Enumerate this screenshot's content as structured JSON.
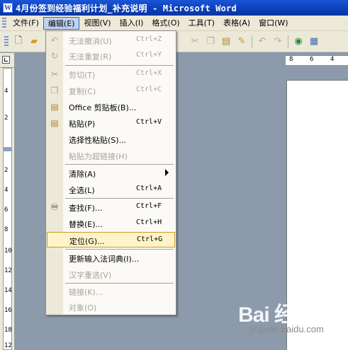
{
  "window": {
    "title": "4月份签到经验福利计划_补充说明 - Microsoft Word",
    "icon_letter": "W"
  },
  "menubar": {
    "items": [
      {
        "label": "文件(F)",
        "id": "file"
      },
      {
        "label": "编辑(E)",
        "id": "edit"
      },
      {
        "label": "视图(V)",
        "id": "view"
      },
      {
        "label": "插入(I)",
        "id": "insert"
      },
      {
        "label": "格式(O)",
        "id": "format"
      },
      {
        "label": "工具(T)",
        "id": "tools"
      },
      {
        "label": "表格(A)",
        "id": "table"
      },
      {
        "label": "窗口(W)",
        "id": "window"
      }
    ]
  },
  "toolbar": {
    "icons": [
      "new-icon",
      "open-icon",
      "save-icon",
      "cut-icon",
      "copy-icon",
      "paste-icon",
      "format-painter-icon",
      "undo-icon",
      "redo-icon",
      "hyperlink-icon",
      "tables-icon"
    ]
  },
  "ruler": {
    "h_labels": [
      "8",
      "6",
      "4"
    ],
    "v_labels": [
      "4",
      "2",
      "2",
      "4",
      "6",
      "8",
      "10",
      "12",
      "14",
      "16",
      "18",
      "12"
    ]
  },
  "edit_menu": {
    "items": [
      {
        "label": "无法撤消(U)",
        "shortcut": "Ctrl+Z",
        "disabled": true,
        "icon": "undo-icon"
      },
      {
        "label": "无法重复(R)",
        "shortcut": "Ctrl+Y",
        "disabled": true,
        "icon": "redo-icon"
      },
      {
        "label": "剪切(T)",
        "shortcut": "Ctrl+X",
        "disabled": true,
        "icon": "cut-icon"
      },
      {
        "label": "复制(C)",
        "shortcut": "Ctrl+C",
        "disabled": true,
        "icon": "copy-icon"
      },
      {
        "label": "Office 剪贴板(B)...",
        "shortcut": "",
        "disabled": false,
        "icon": "clipboard-icon"
      },
      {
        "label": "粘贴(P)",
        "shortcut": "Ctrl+V",
        "disabled": false,
        "icon": "paste-icon"
      },
      {
        "label": "选择性粘贴(S)...",
        "shortcut": "",
        "disabled": false,
        "icon": ""
      },
      {
        "label": "粘贴为超链接(H)",
        "shortcut": "",
        "disabled": true,
        "icon": ""
      },
      {
        "label": "清除(A)",
        "shortcut": "",
        "disabled": false,
        "icon": "",
        "submenu": true
      },
      {
        "label": "全选(L)",
        "shortcut": "Ctrl+A",
        "disabled": false,
        "icon": ""
      },
      {
        "label": "查找(F)...",
        "shortcut": "Ctrl+F",
        "disabled": false,
        "icon": "binoculars-icon"
      },
      {
        "label": "替换(E)...",
        "shortcut": "Ctrl+H",
        "disabled": false,
        "icon": ""
      },
      {
        "label": "定位(G)...",
        "shortcut": "Ctrl+G",
        "disabled": false,
        "icon": "",
        "highlighted": true
      },
      {
        "label": "更新输入法词典(I)...",
        "shortcut": "",
        "disabled": false,
        "icon": ""
      },
      {
        "label": "汉字重选(V)",
        "shortcut": "",
        "disabled": true,
        "icon": ""
      },
      {
        "label": "链接(K)...",
        "shortcut": "",
        "disabled": true,
        "icon": ""
      },
      {
        "label": "对象(O)",
        "shortcut": "",
        "disabled": true,
        "icon": ""
      }
    ]
  },
  "watermark": {
    "logo": "Bai  经验",
    "url": "jingyan.baidu.com"
  },
  "colors": {
    "titlebar": "#0a3fb8",
    "menu_highlight": "#c1d2ee",
    "item_highlight": "#fff4c9",
    "workspace": "#8c9aab"
  }
}
